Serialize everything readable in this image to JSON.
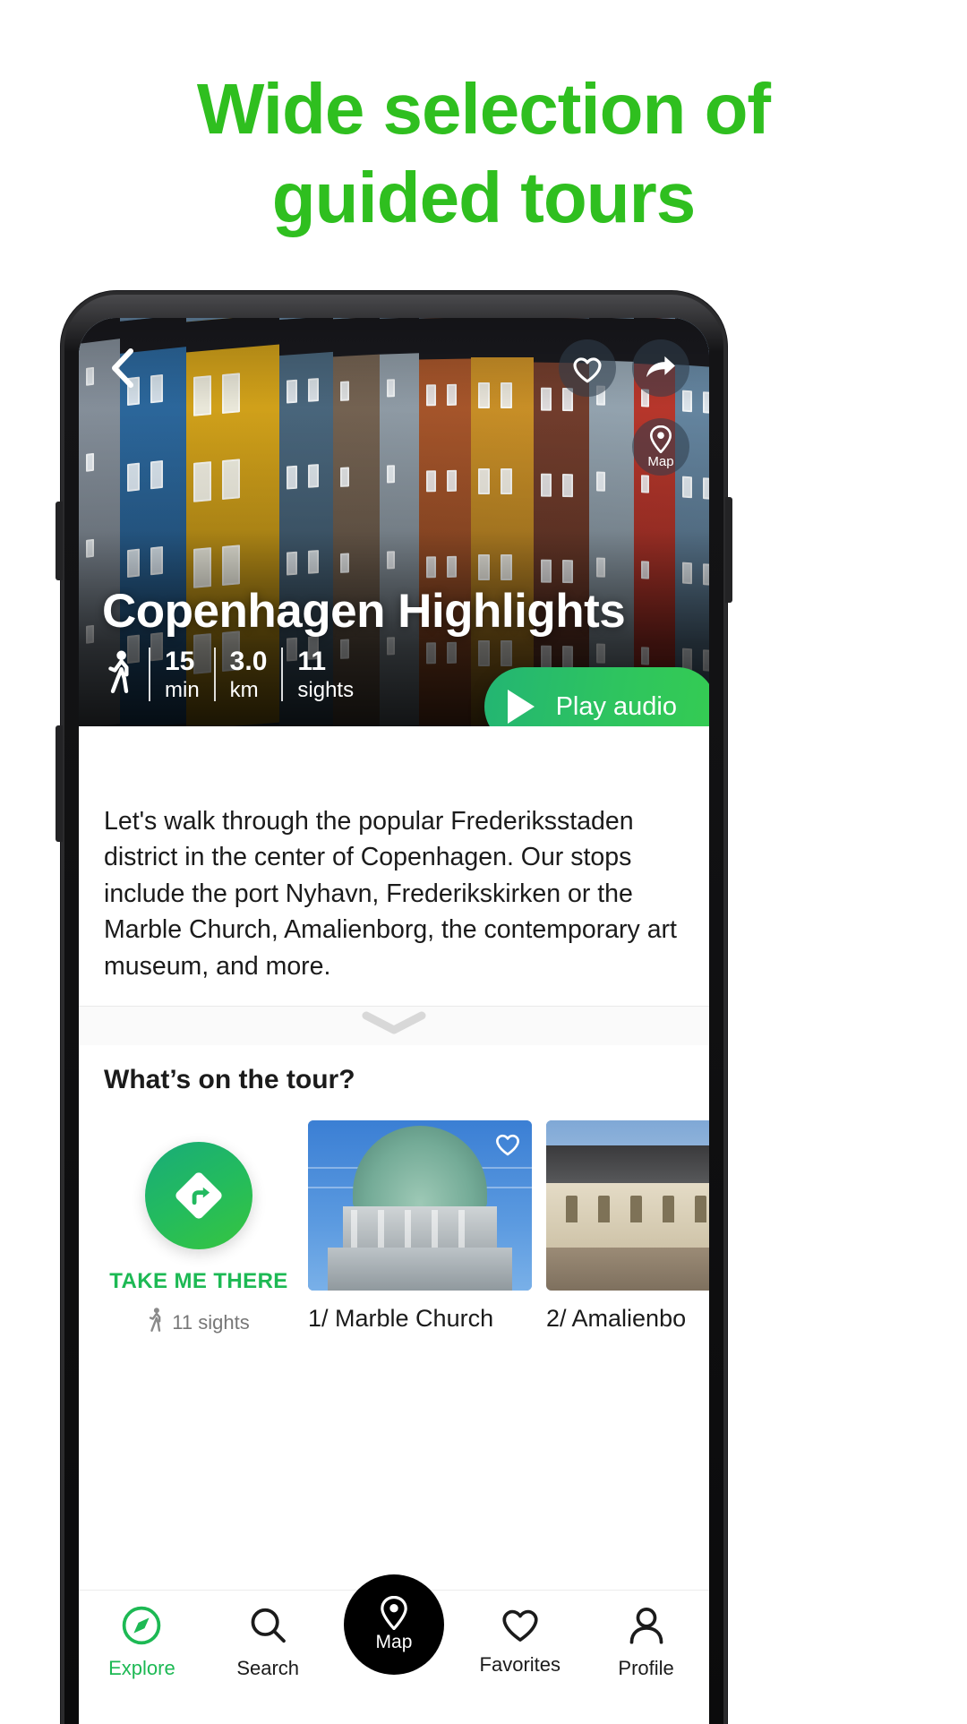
{
  "headline": {
    "line1": "Wide selection of",
    "line2": "guided tours",
    "color": "#2fbf1f"
  },
  "app": {
    "hero": {
      "back_icon": "chevron-left-icon",
      "favorite_icon": "heart-icon",
      "share_icon": "share-arrow-icon",
      "map_icon": "map-pin-icon",
      "map_label": "Map",
      "title": "Copenhagen Highlights",
      "walk_icon": "walking-person-icon",
      "stats": [
        {
          "value": "15",
          "unit": "min"
        },
        {
          "value": "3.0",
          "unit": "km"
        },
        {
          "value": "11",
          "unit": "sights"
        }
      ],
      "play_audio": {
        "label": "Play audio",
        "icon": "play-triangle-icon",
        "color": "#2ec45f"
      }
    },
    "description": "Let's walk through the popular Frederiksstaden district in the center of Copenhagen. Our stops include the port Nyhavn, Frederikskirken or the Marble Church, Amalienborg, the contemporary art museum, and more.",
    "sheet_handle_icon": "chevron-down-icon",
    "tour": {
      "heading": "What’s on the tour?",
      "take_me_there": {
        "label": "TAKE ME THERE",
        "icon": "directions-diamond-icon",
        "sights_icon": "walking-person-icon",
        "sights_text": "11 sights",
        "color": "#1db954"
      },
      "cards": [
        {
          "caption": "1/ Marble Church",
          "favorite_icon": "heart-icon",
          "image": "marble-church-dome"
        },
        {
          "caption": "2/ Amalienbo",
          "favorite_icon": "heart-icon",
          "image": "amalienborg-palace"
        }
      ]
    },
    "bottom_nav": {
      "items": [
        {
          "label": "Explore",
          "icon": "compass-icon",
          "active": true
        },
        {
          "label": "Search",
          "icon": "search-icon",
          "active": false
        },
        {
          "label": "Map",
          "icon": "map-pin-icon",
          "active": false,
          "primary": true
        },
        {
          "label": "Favorites",
          "icon": "heart-icon",
          "active": false
        },
        {
          "label": "Profile",
          "icon": "person-icon",
          "active": false
        }
      ],
      "active_color": "#1db954"
    }
  }
}
